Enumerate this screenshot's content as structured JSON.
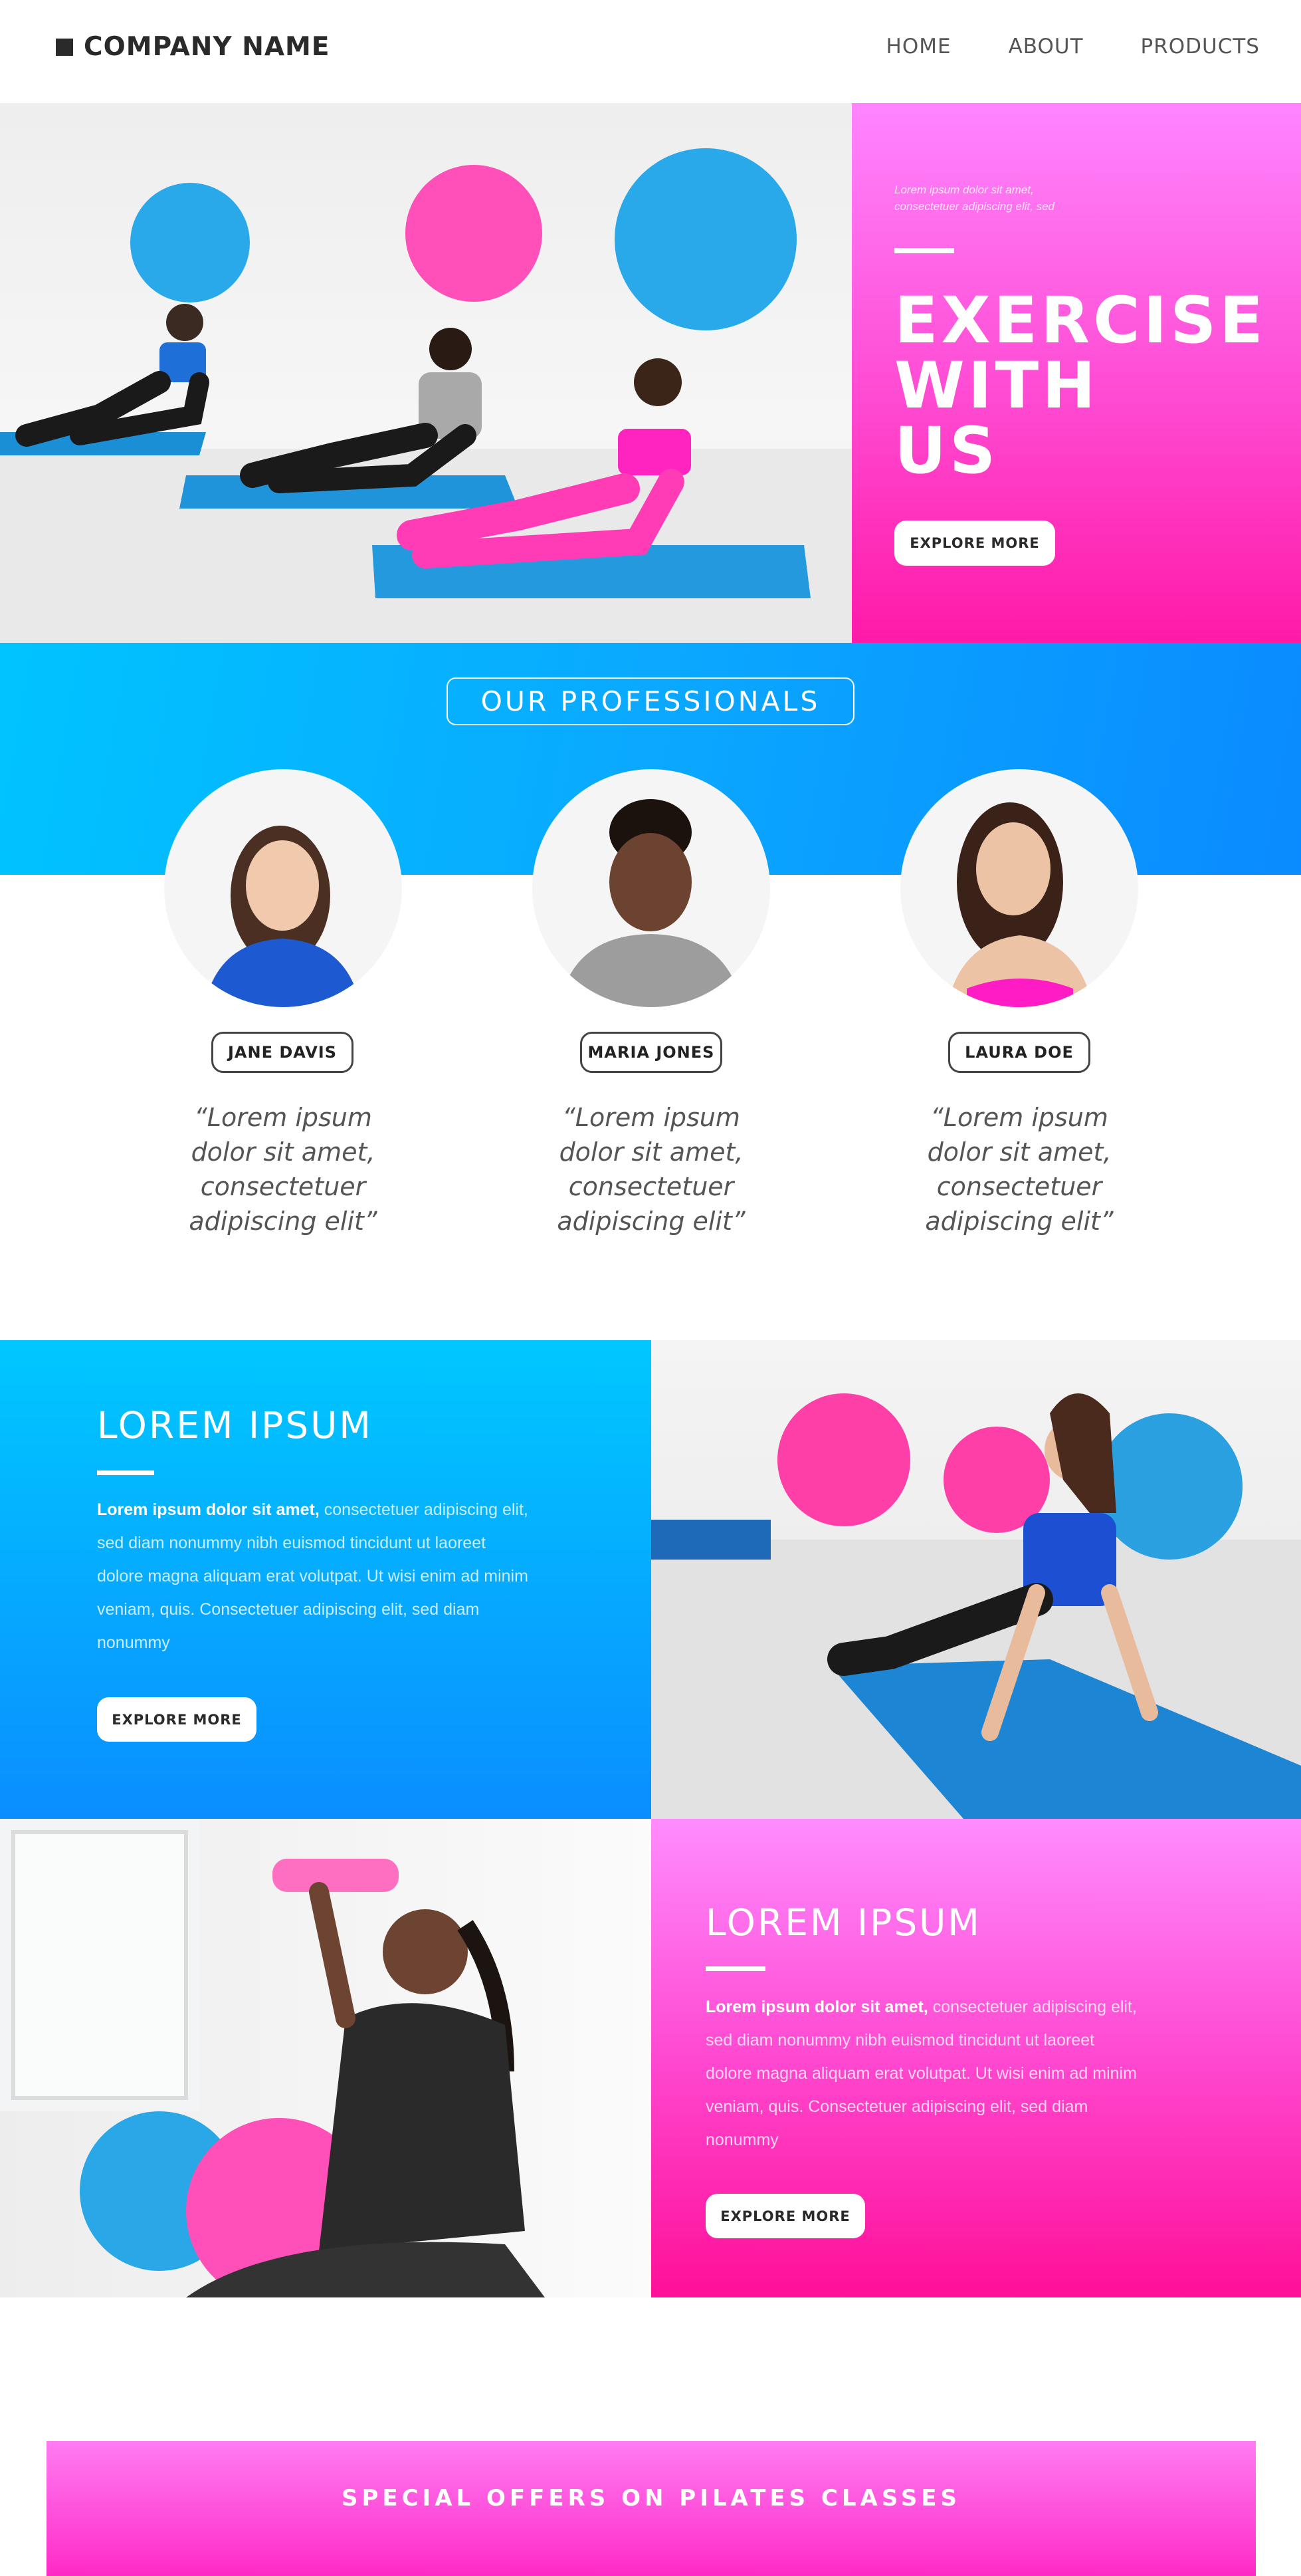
{
  "header": {
    "company_name": "COMPANY NAME",
    "nav": [
      "HOME",
      "ABOUT",
      "PRODUCTS"
    ]
  },
  "hero": {
    "small_text_line1": "Lorem ipsum dolor sit amet,",
    "small_text_line2": "consectetuer adipiscing elit, sed",
    "title_line1": "EXERCISE",
    "title_line2": "WITH",
    "title_line3": "US",
    "button": "EXPLORE MORE"
  },
  "professionals": {
    "title": "OUR PROFESSIONALS",
    "people": [
      {
        "name": "JANE DAVIS",
        "quote": [
          "“Lorem ipsum",
          "dolor sit amet,",
          "consectetuer",
          "adipiscing elit”"
        ]
      },
      {
        "name": "MARIA JONES",
        "quote": [
          "“Lorem ipsum",
          "dolor sit amet,",
          "consectetuer",
          "adipiscing elit”"
        ]
      },
      {
        "name": "LAURA DOE",
        "quote": [
          "“Lorem ipsum",
          "dolor sit amet,",
          "consectetuer",
          "adipiscing elit”"
        ]
      }
    ]
  },
  "feature1": {
    "title": "LOREM IPSUM",
    "bold": "Lorem ipsum dolor sit amet,",
    "body": " consectetuer adipiscing elit, sed diam nonummy nibh euismod tincidunt ut laoreet dolore magna aliquam erat volutpat. Ut wisi enim ad minim veniam, quis. Consectetuer adipiscing elit, sed diam nonummy",
    "button": "EXPLORE MORE"
  },
  "feature2": {
    "title": "LOREM IPSUM",
    "bold": "Lorem ipsum dolor sit amet,",
    "body": " consectetuer adipiscing elit, sed diam nonummy nibh euismod tincidunt ut laoreet dolore magna aliquam erat volutpat. Ut wisi enim ad minim veniam, quis. Consectetuer adipiscing elit, sed diam nonummy",
    "button": "EXPLORE MORE"
  },
  "offer": {
    "text": "SPECIAL OFFERS ON PILATES CLASSES"
  },
  "colors": {
    "pink": "#ff2ac6",
    "blue": "#0aa8ff",
    "dark": "#2a2a2a"
  },
  "icons": [
    "logo-square-icon"
  ]
}
